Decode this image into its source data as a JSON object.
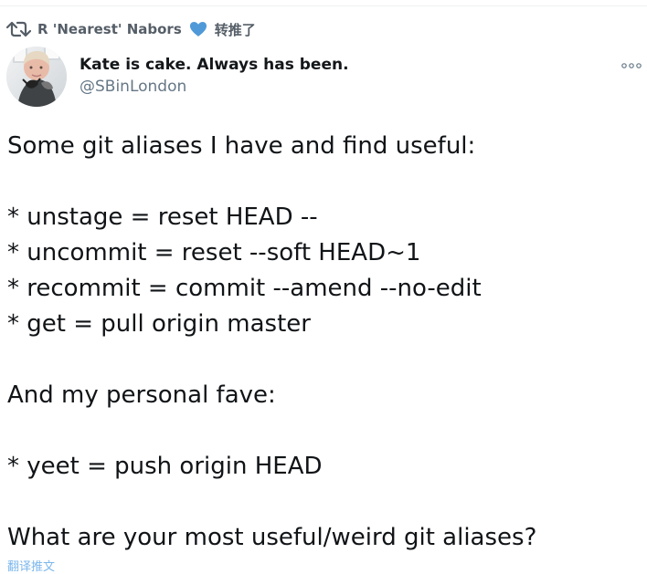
{
  "retweet": {
    "icon": "retweet-icon",
    "name": "R 'Nearest' Nabors",
    "heart": "blue-heart-icon",
    "action": "转推了"
  },
  "author": {
    "avatar": "profile-avatar",
    "display_name": "Kate is cake. Always has been.",
    "handle": "@SBinLondon"
  },
  "menu": {
    "icon": "more-icon"
  },
  "tweet": {
    "lines": [
      "Some git aliases I have and find useful:",
      "",
      "* unstage = reset HEAD --",
      "* uncommit = reset --soft HEAD~1",
      "* recommit = commit --amend --no-edit",
      "* get = pull origin master",
      "",
      "And my personal fave:",
      "",
      "* yeet = push origin HEAD",
      "",
      "What are your most useful/weird git aliases?"
    ]
  },
  "translate": {
    "label": "翻译推文"
  },
  "colors": {
    "retweet_gray": "#555e67",
    "heart_blue": "#4f99d8",
    "handle_gray": "#657786",
    "link_blue": "#7cb7ec"
  }
}
